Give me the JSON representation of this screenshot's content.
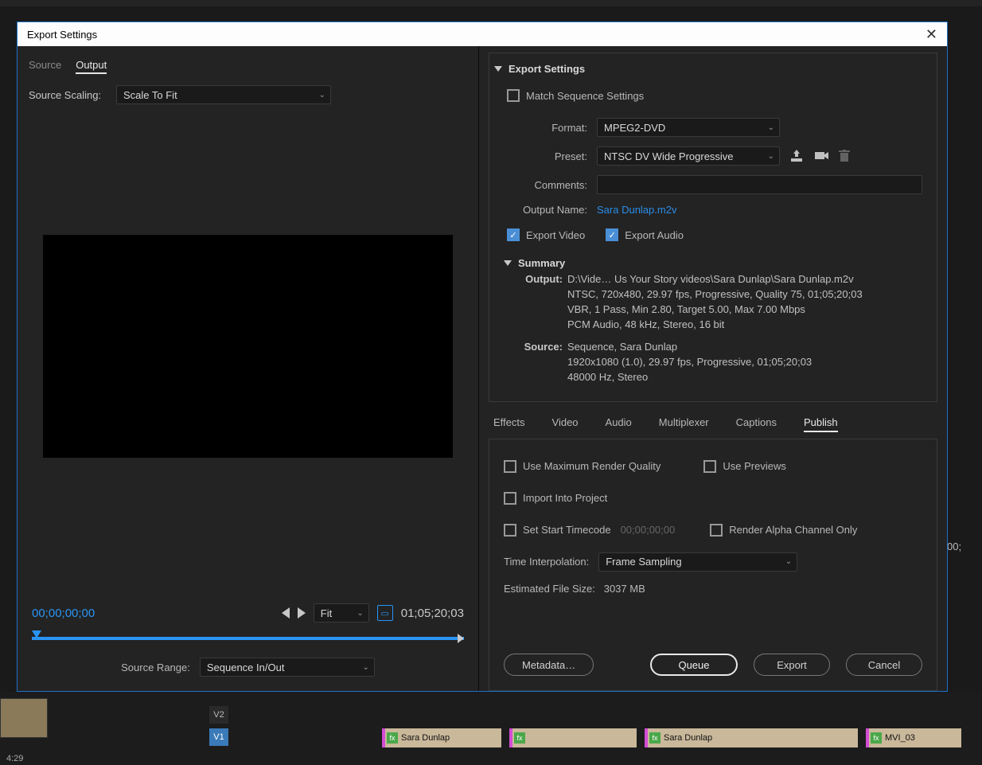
{
  "dialog": {
    "title": "Export Settings",
    "left": {
      "tabs": {
        "source": "Source",
        "output": "Output"
      },
      "scaling_label": "Source Scaling:",
      "scaling_value": "Scale To Fit",
      "zoom_value": "Fit",
      "tc_start": "00;00;00;00",
      "tc_end": "01;05;20;03",
      "source_range_label": "Source Range:",
      "source_range_value": "Sequence In/Out"
    },
    "right": {
      "export_settings_title": "Export Settings",
      "match_sequence": "Match Sequence Settings",
      "format_label": "Format:",
      "format_value": "MPEG2-DVD",
      "preset_label": "Preset:",
      "preset_value": "NTSC DV Wide Progressive",
      "comments_label": "Comments:",
      "comments_value": "",
      "output_name_label": "Output Name:",
      "output_name_value": "Sara Dunlap.m2v",
      "export_video": "Export Video",
      "export_audio": "Export Audio",
      "summary_title": "Summary",
      "summary": {
        "output_label": "Output:",
        "output_text": "D:\\Vide… Us Your Story videos\\Sara Dunlap\\Sara Dunlap.m2v\nNTSC, 720x480, 29.97 fps, Progressive, Quality 75, 01;05;20;03\nVBR, 1 Pass, Min 2.80, Target 5.00, Max 7.00 Mbps\nPCM Audio, 48 kHz, Stereo, 16 bit",
        "source_label": "Source:",
        "source_text": "Sequence, Sara Dunlap\n1920x1080 (1.0), 29.97 fps, Progressive, 01;05;20;03\n48000 Hz, Stereo"
      },
      "tabs": [
        "Effects",
        "Video",
        "Audio",
        "Multiplexer",
        "Captions",
        "Publish"
      ],
      "active_tab": "Publish",
      "opts": {
        "max_render": "Use Maximum Render Quality",
        "use_previews": "Use Previews",
        "import_project": "Import Into Project",
        "set_start_tc": "Set Start Timecode",
        "tc_placeholder": "00;00;00;00",
        "render_alpha": "Render Alpha Channel Only",
        "time_interp_label": "Time Interpolation:",
        "time_interp_value": "Frame Sampling",
        "est_size_label": "Estimated File Size:",
        "est_size_value": "3037 MB"
      },
      "buttons": {
        "metadata": "Metadata…",
        "queue": "Queue",
        "export": "Export",
        "cancel": "Cancel"
      }
    }
  },
  "bg_timeline": {
    "clips": [
      "Sara Dunlap",
      "Sara Dunlap",
      "MVI_03"
    ],
    "v_labels": [
      "V2",
      "V1"
    ],
    "tc_right": "00;",
    "time_bottom": "4:29"
  }
}
